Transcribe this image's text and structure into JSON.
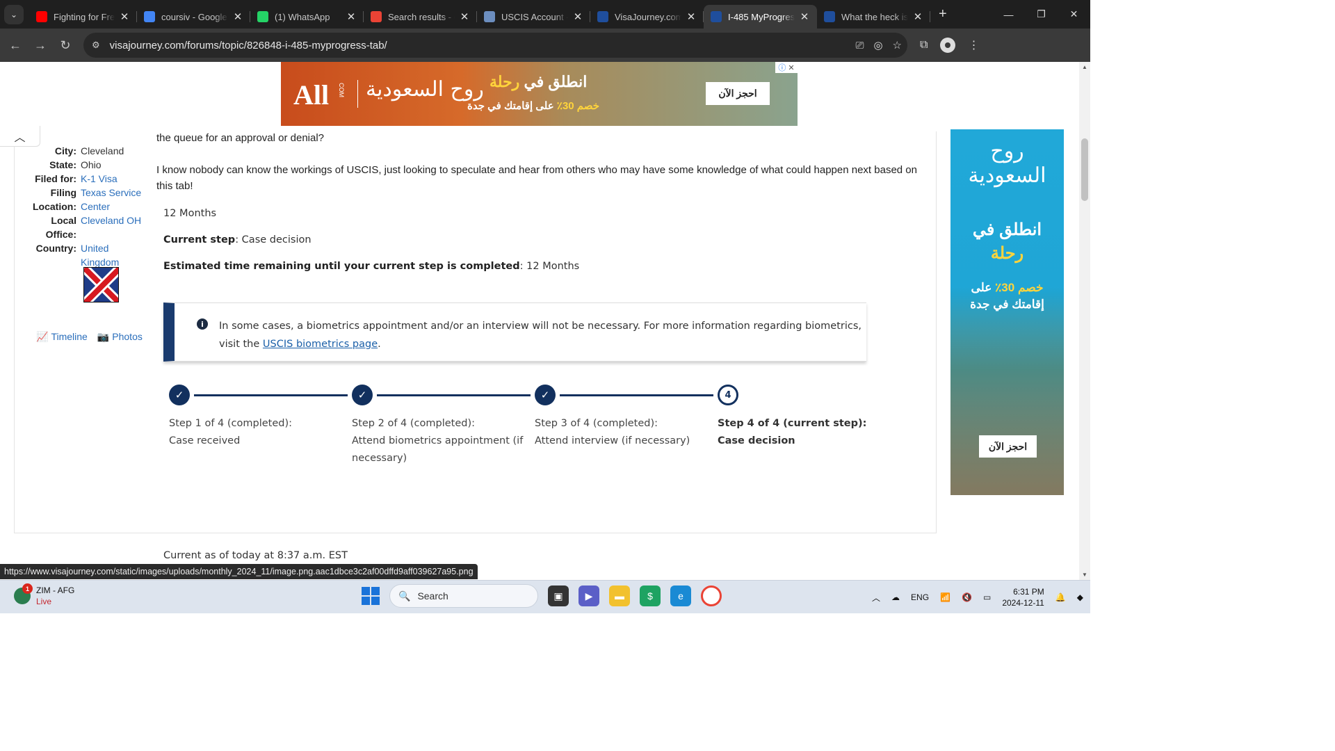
{
  "browser": {
    "tabs": [
      {
        "title": "Fighting for Free",
        "favicon": "youtube-icon",
        "color": "#ff0000"
      },
      {
        "title": "coursiv - Google",
        "favicon": "google-icon",
        "color": "#4285f4"
      },
      {
        "title": "(1) WhatsApp",
        "favicon": "whatsapp-icon",
        "color": "#25d366"
      },
      {
        "title": "Search results - c",
        "favicon": "gmail-icon",
        "color": "#ea4335"
      },
      {
        "title": "USCIS Account -",
        "favicon": "uscis-icon",
        "color": "#6c8ebf"
      },
      {
        "title": "VisaJourney.com",
        "favicon": "visajourney-icon",
        "color": "#1f4e9c"
      },
      {
        "title": "I-485 MyProgres",
        "favicon": "visajourney-icon",
        "color": "#1f4e9c",
        "active": true
      },
      {
        "title": "What the heck is",
        "favicon": "visajourney-icon",
        "color": "#1f4e9c"
      }
    ],
    "url": "visajourney.com/forums/topic/826848-i-485-myprogress-tab/",
    "status_url": "https://www.visajourney.com/static/images/uploads/monthly_2024_11/image.png.aac1dbce3c2af00dffd9aff039627a95.png"
  },
  "top_ad": {
    "logo": "All",
    "logo_suffix": "COM",
    "brand": "روح السعودية",
    "headline_white": "انطلق في",
    "headline_yellow": "رحلة",
    "sub_yellow": "خصم 30٪",
    "sub_white": "على إقامتك في جدة",
    "cta": "احجز الآن"
  },
  "profile": {
    "rows": [
      {
        "label": "City:",
        "value": "Cleveland",
        "link": false
      },
      {
        "label": "State:",
        "value": "Ohio",
        "link": false
      },
      {
        "label": "Filed for:",
        "value": "K-1 Visa",
        "link": true
      },
      {
        "label": "Filing Location:",
        "value": "Texas Service Center",
        "link": true
      },
      {
        "label": "Local Office:",
        "value": "Cleveland OH",
        "link": true
      },
      {
        "label": "Country:",
        "value": "United Kingdom",
        "link": true
      }
    ],
    "timeline_link": "Timeline",
    "photos_link": "Photos"
  },
  "post": {
    "paragraph_1": "the queue for an approval or denial?",
    "paragraph_2": "I know nobody can know the workings of USCIS, just looking to speculate and hear from others who may have some knowledge of what could happen next based on this tab!"
  },
  "progress": {
    "duration": "12 Months",
    "current_step_label": "Current step",
    "current_step_value": ": Case decision",
    "estimated_label": "Estimated time remaining until your current step is completed",
    "estimated_value": ": 12 Months",
    "alert_text": "In some cases, a biometrics appointment and/or an interview will not be necessary. For more information regarding biometrics, visit the ",
    "alert_link": "USCIS biometrics page",
    "alert_end": ".",
    "steps": [
      {
        "title": "Step 1 of 4 (completed):",
        "detail": "Case received",
        "status": "done"
      },
      {
        "title": "Step 2 of 4 (completed):",
        "detail": "Attend biometrics appointment (if necessary)",
        "status": "done"
      },
      {
        "title": "Step 3 of 4 (completed):",
        "detail": "Attend interview (if necessary)",
        "status": "done"
      },
      {
        "title": "Step 4 of 4 (current step):",
        "detail": "Case decision",
        "status": "current",
        "number": "4"
      }
    ],
    "current_as_of": "Current as of today at 8:37 a.m. EST"
  },
  "side_ad": {
    "brand": "روح السعودية",
    "head_white": "انطلق في",
    "head_yellow": "رحلة",
    "sub_yellow": "خصم 30٪",
    "sub_white_1": "على",
    "sub_white_2": "إقامتك في جدة",
    "cta": "احجز الآن"
  },
  "taskbar": {
    "weather_title": "ZIM - AFG",
    "weather_sub": "Live",
    "weather_badge": "1",
    "search_placeholder": "Search",
    "language": "ENG",
    "time": "6:31 PM",
    "date": "2024-12-11"
  }
}
